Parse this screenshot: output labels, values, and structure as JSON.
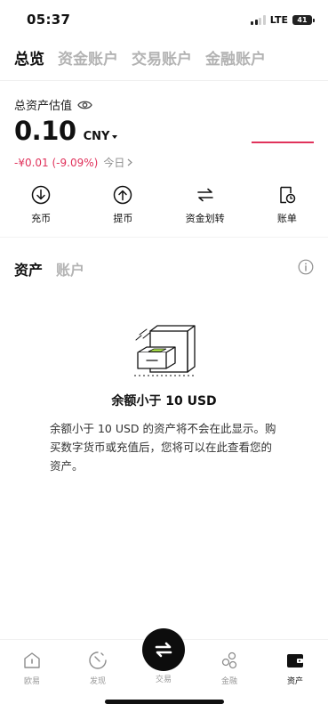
{
  "status_bar": {
    "time": "05:37",
    "network": "LTE",
    "battery": "41"
  },
  "top_tabs": [
    {
      "label": "总览",
      "active": true
    },
    {
      "label": "资金账户",
      "active": false
    },
    {
      "label": "交易账户",
      "active": false
    },
    {
      "label": "金融账户",
      "active": false
    }
  ],
  "overview": {
    "estimate_label": "总资产估值",
    "balance": "0.10",
    "currency": "CNY",
    "pnl": "-¥0.01 (-9.09%)",
    "pnl_period": "今日",
    "pnl_color": "#e0325b"
  },
  "actions": [
    {
      "label": "充币",
      "icon": "deposit-icon"
    },
    {
      "label": "提币",
      "icon": "withdraw-icon"
    },
    {
      "label": "资金划转",
      "icon": "transfer-icon"
    },
    {
      "label": "账单",
      "icon": "bill-icon"
    }
  ],
  "sub_tabs": [
    {
      "label": "资产",
      "active": true
    },
    {
      "label": "账户",
      "active": false
    }
  ],
  "empty_state": {
    "title": "余额小于 10 USD",
    "description": "余额小于 10 USD 的资产将不会在此显示。购买数字货币或充值后，您将可以在此查看您的资产。"
  },
  "bottom_nav": [
    {
      "label": "欧易",
      "icon": "home-icon"
    },
    {
      "label": "发现",
      "icon": "discover-icon"
    },
    {
      "label": "交易",
      "icon": "trade-icon"
    },
    {
      "label": "金融",
      "icon": "finance-icon"
    },
    {
      "label": "资产",
      "icon": "wallet-icon",
      "active": true
    }
  ],
  "colors": {
    "accent": "#111111",
    "negative": "#e0325b",
    "muted": "#b3b3b3",
    "illustration_accent": "#b5f04e"
  }
}
